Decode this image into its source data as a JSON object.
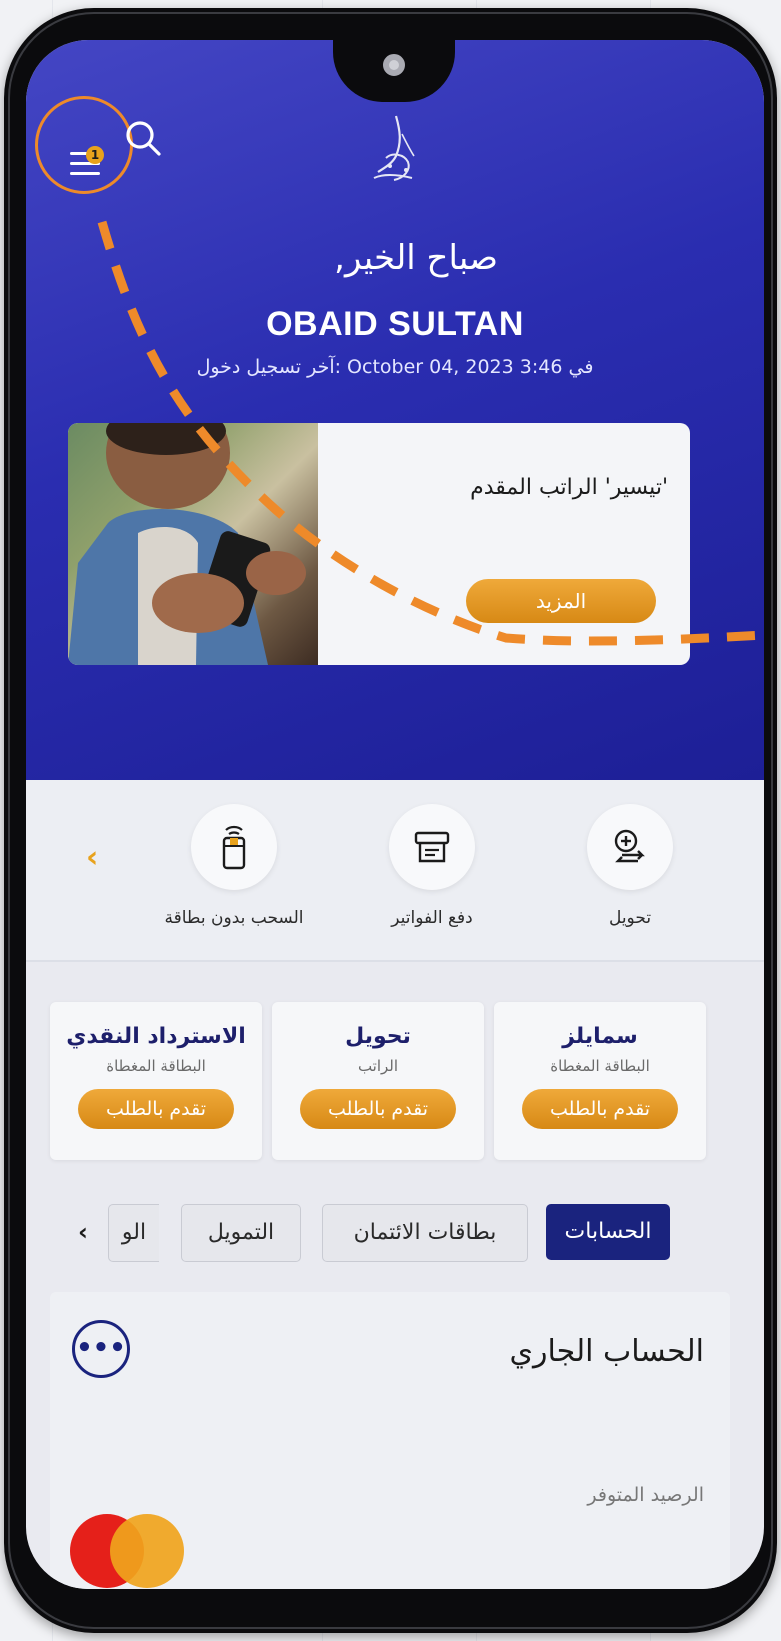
{
  "header": {
    "menu_badge": "1",
    "greeting": "صباح الخير,",
    "user_name": "OBAID SULTAN",
    "last_login": "آخر تسجيل دخول: October 04, 2023 في 3:46"
  },
  "promo": {
    "title": "'تيسير' الراتب المقدم",
    "more_label": "المزيد"
  },
  "quick_actions": [
    {
      "label": "تحويل",
      "icon": "transfer-icon"
    },
    {
      "label": "دفع الفواتير",
      "icon": "bill-payment-icon"
    },
    {
      "label": "السحب بدون بطاقة",
      "icon": "cardless-withdrawal-icon"
    }
  ],
  "offers": [
    {
      "title": "سمايلز",
      "subtitle": "البطاقة المغطاة",
      "button": "تقدم بالطلب"
    },
    {
      "title": "تحويل",
      "subtitle": "الراتب",
      "button": "تقدم بالطلب"
    },
    {
      "title": "الاسترداد النقدي",
      "subtitle": "البطاقة المغطاة",
      "button": "تقدم بالطلب"
    }
  ],
  "tabs": [
    {
      "label": "الحسابات",
      "active": true
    },
    {
      "label": "بطاقات الائتمان",
      "active": false
    },
    {
      "label": "التمويل",
      "active": false
    },
    {
      "label": "الو",
      "active": false
    }
  ],
  "account": {
    "title": "الحساب الجاري",
    "balance_label": "الرصيد المتوفر",
    "more_label": "•••"
  },
  "colors": {
    "primary": "#1a237e",
    "accent": "#e8a21c",
    "highlight_ring": "#ee8a2a"
  }
}
